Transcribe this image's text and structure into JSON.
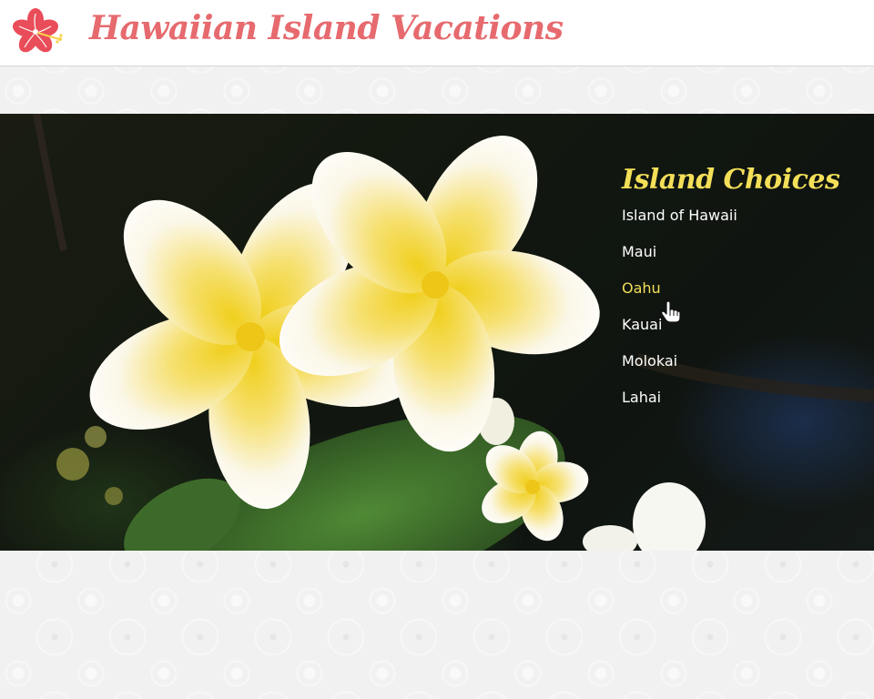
{
  "header": {
    "title": "Hawaiian Island Vacations",
    "logo_icon": "hibiscus-flower-icon",
    "title_color": "#e66a6e"
  },
  "hero": {
    "image": "white-yellow-plumeria-flowers-photo",
    "menu": {
      "title": "Island Choices",
      "title_color": "#f3df58",
      "items": [
        {
          "label": "Island of Hawaii",
          "active": false
        },
        {
          "label": "Maui",
          "active": false
        },
        {
          "label": "Oahu",
          "active": true
        },
        {
          "label": "Kauai",
          "active": false
        },
        {
          "label": "Molokai",
          "active": false
        },
        {
          "label": "Lahai",
          "active": false
        }
      ],
      "hover_color": "#f3df58"
    }
  },
  "cursor": {
    "type": "pointer-hand-icon"
  }
}
